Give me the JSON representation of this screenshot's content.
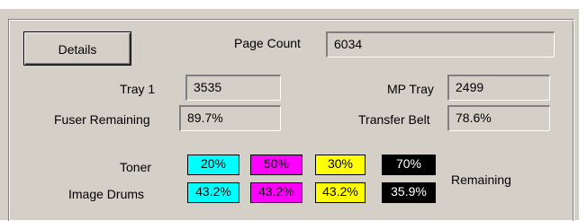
{
  "details_button": "Details",
  "page_count": {
    "label": "Page Count",
    "value": "6034"
  },
  "tray1": {
    "label": "Tray 1",
    "value": "3535"
  },
  "mp_tray": {
    "label": "MP Tray",
    "value": "2499"
  },
  "fuser": {
    "label": "Fuser Remaining",
    "value": "89.7%"
  },
  "transfer_belt": {
    "label": "Transfer Belt",
    "value": "78.6%"
  },
  "toner": {
    "label": "Toner",
    "items": [
      {
        "color": "cyan",
        "hex": "#00ffff",
        "value": "20%"
      },
      {
        "color": "magenta",
        "hex": "#ff00ff",
        "value": "50%"
      },
      {
        "color": "yellow",
        "hex": "#ffff00",
        "value": "30%"
      },
      {
        "color": "black",
        "hex": "#000000",
        "value": "70%"
      }
    ]
  },
  "image_drums": {
    "label": "Image Drums",
    "items": [
      {
        "color": "cyan",
        "hex": "#00ffff",
        "value": "43.2%"
      },
      {
        "color": "magenta",
        "hex": "#ff00ff",
        "value": "43.2%"
      },
      {
        "color": "yellow",
        "hex": "#ffff00",
        "value": "43.2%"
      },
      {
        "color": "black",
        "hex": "#000000",
        "value": "35.9%"
      }
    ]
  },
  "remaining_label": "Remaining"
}
